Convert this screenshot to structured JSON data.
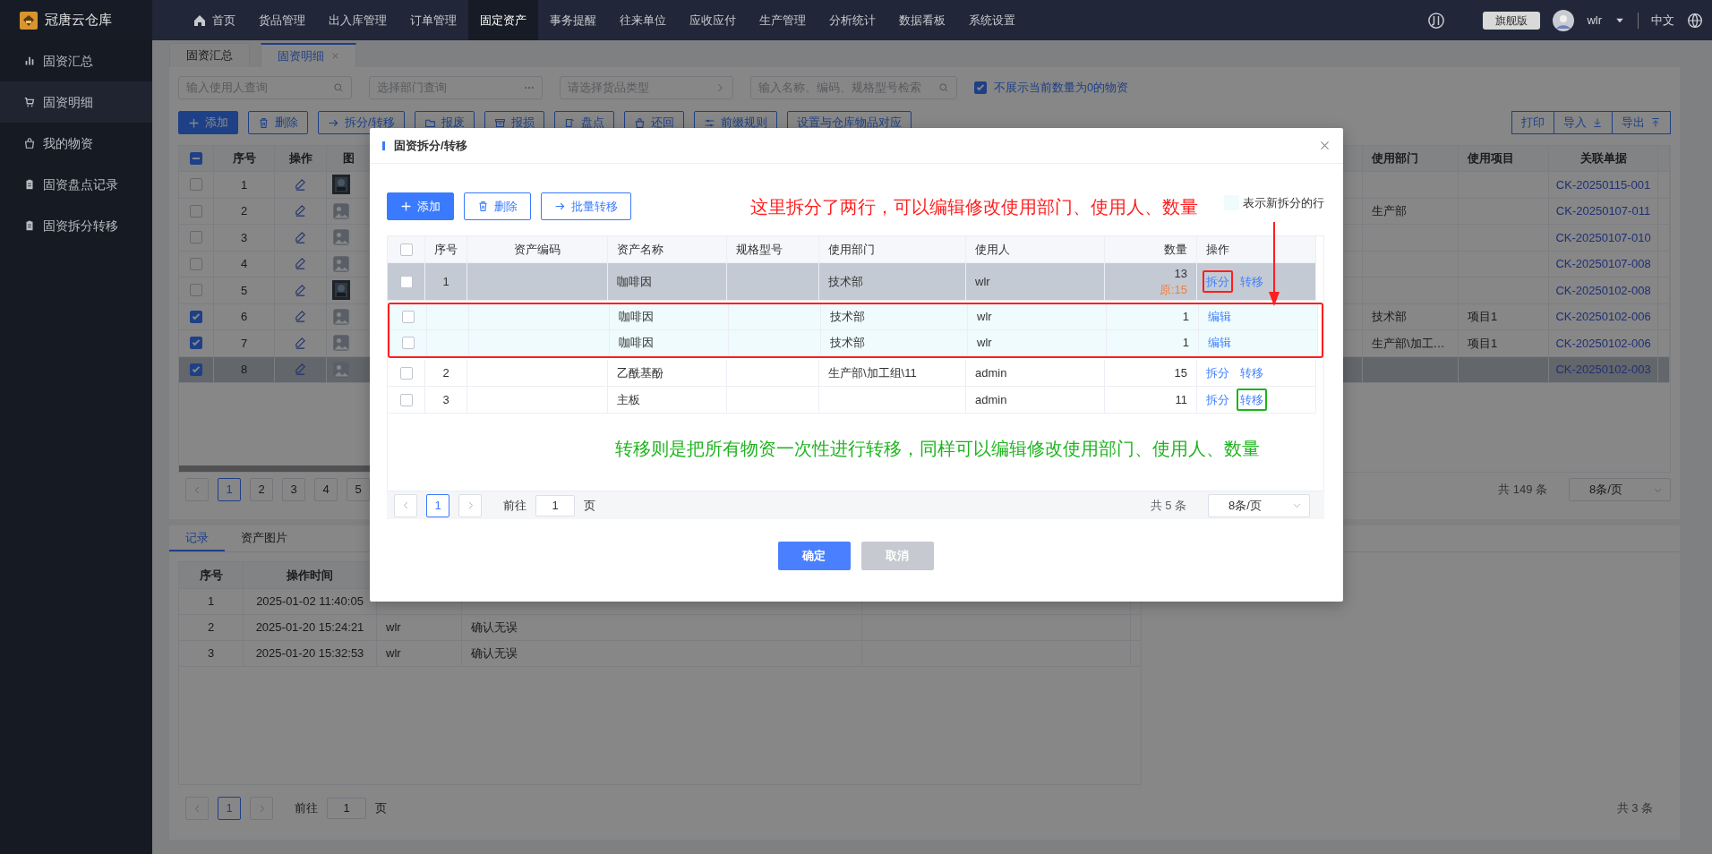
{
  "app": {
    "logo_text": "冠唐云仓库"
  },
  "top_nav": {
    "items": [
      {
        "label": "首页",
        "selected": false
      },
      {
        "label": "货品管理",
        "selected": false
      },
      {
        "label": "出入库管理",
        "selected": false
      },
      {
        "label": "订单管理",
        "selected": false
      },
      {
        "label": "固定资产",
        "selected": true
      },
      {
        "label": "事务提醒",
        "selected": false
      },
      {
        "label": "往来单位",
        "selected": false
      },
      {
        "label": "应收应付",
        "selected": false
      },
      {
        "label": "生产管理",
        "selected": false
      },
      {
        "label": "分析统计",
        "selected": false
      },
      {
        "label": "数据看板",
        "selected": false
      },
      {
        "label": "系统设置",
        "selected": false
      }
    ],
    "edition": "旗舰版",
    "user": "wlr",
    "language": "中文"
  },
  "sidebar": {
    "items": [
      {
        "label": "固资汇总",
        "selected": false
      },
      {
        "label": "固资明细",
        "selected": true
      },
      {
        "label": "我的物资",
        "selected": false
      },
      {
        "label": "固资盘点记录",
        "selected": false
      },
      {
        "label": "固资拆分转移",
        "selected": false
      }
    ]
  },
  "page_tabs": [
    {
      "label": "固资汇总",
      "selected": false,
      "closable": false
    },
    {
      "label": "固资明细",
      "selected": true,
      "closable": true
    }
  ],
  "filters": [
    {
      "kind": "search",
      "placeholder": "输入使用人查询"
    },
    {
      "kind": "more",
      "placeholder": "选择部门查询"
    },
    {
      "kind": "cascade",
      "placeholder": "请选择货品类型"
    },
    {
      "kind": "search",
      "placeholder": "输入名称、编码、规格型号检索"
    }
  ],
  "hide_zero": {
    "label": "不展示当前数量为0的物资",
    "checked": true
  },
  "toolbar": [
    {
      "label": "添加",
      "kind": "primary"
    },
    {
      "label": "删除",
      "kind": "outline"
    },
    {
      "label": "拆分/转移",
      "kind": "outline"
    },
    {
      "label": "报废",
      "kind": "outline"
    },
    {
      "label": "报损",
      "kind": "outline"
    },
    {
      "label": "盘点",
      "kind": "outline"
    },
    {
      "label": "还回",
      "kind": "outline"
    },
    {
      "label": "前缀规则",
      "kind": "outline"
    },
    {
      "label": "设置与仓库物品对应",
      "kind": "outline"
    }
  ],
  "export_buttons": [
    {
      "label": "打印"
    },
    {
      "label": "导入"
    },
    {
      "label": "导出"
    }
  ],
  "asset_table": {
    "columns": [
      "序号",
      "操作",
      "图",
      "使用部门",
      "使用项目",
      "关联单据"
    ],
    "select_all_indeterminate": true,
    "rows": [
      {
        "seq": "1",
        "checked": false,
        "selected": false,
        "has_photo": true,
        "document": "CK-20250115-001"
      },
      {
        "seq": "2",
        "checked": false,
        "selected": false,
        "has_photo": false,
        "department": "生产部",
        "document": "CK-20250107-011"
      },
      {
        "seq": "3",
        "checked": false,
        "selected": false,
        "has_photo": false,
        "document": "CK-20250107-010"
      },
      {
        "seq": "4",
        "checked": false,
        "selected": false,
        "has_photo": false,
        "document": "CK-20250107-008"
      },
      {
        "seq": "5",
        "checked": false,
        "selected": false,
        "has_photo": true,
        "document": "CK-20250102-008"
      },
      {
        "seq": "6",
        "checked": true,
        "selected": false,
        "has_photo": false,
        "department": "技术部",
        "project": "项目1",
        "document": "CK-20250102-006"
      },
      {
        "seq": "7",
        "checked": true,
        "selected": false,
        "has_photo": false,
        "department": "生产部\\加工…",
        "project": "项目1",
        "document": "CK-20250102-006"
      },
      {
        "seq": "8",
        "checked": true,
        "selected": true,
        "has_photo": false,
        "document": "CK-20250102-003"
      }
    ]
  },
  "asset_pagination": {
    "pages": [
      {
        "label": "1",
        "selected": true
      },
      {
        "label": "2",
        "selected": false
      },
      {
        "label": "3",
        "selected": false
      },
      {
        "label": "4",
        "selected": false
      },
      {
        "label": "5",
        "selected": false
      }
    ],
    "total": "共 149 条",
    "page_size": "8条/页"
  },
  "detail_tabs": [
    {
      "label": "记录",
      "selected": true
    },
    {
      "label": "资产图片",
      "selected": false
    }
  ],
  "record_table": {
    "columns": [
      "序号",
      "操作时间"
    ],
    "rows": [
      {
        "seq": "1",
        "time": "2025-01-02 11:40:05"
      },
      {
        "seq": "2",
        "time": "2025-01-20 15:24:21",
        "user": "wlr",
        "content": "确认无误"
      },
      {
        "seq": "3",
        "time": "2025-01-20 15:32:53",
        "user": "wlr",
        "content": "确认无误"
      }
    ]
  },
  "record_pagination": {
    "pages": [
      {
        "label": "1",
        "selected": true
      }
    ],
    "goto_label": "前往",
    "goto_value": "1",
    "unit": "页",
    "total": "共 3 条"
  },
  "modal": {
    "title": "固资拆分/转移",
    "buttons": [
      {
        "label": "添加",
        "kind": "primary"
      },
      {
        "label": "删除",
        "kind": "outline"
      },
      {
        "label": "批量转移",
        "kind": "outline"
      }
    ],
    "notes": [
      {
        "kind": "top",
        "text": "这里拆分了两行，可以编辑修改使用部门、使用人、数量",
        "color": "#ff1e1e"
      },
      {
        "kind": "bottom",
        "text": "转移则是把所有物资一次性进行转移，同样可以编辑修改使用部门、使用人、数量",
        "color": "#1fb41f"
      }
    ],
    "legend": {
      "label": "表示新拆分的行"
    },
    "columns": [
      "序号",
      "资产编码",
      "资产名称",
      "规格型号",
      "使用部门",
      "使用人",
      "数量",
      "操作"
    ],
    "select_all": false,
    "rows": [
      {
        "kind": "item",
        "checked": false,
        "selected": true,
        "seq": "1",
        "name": "咖啡因",
        "department": "技术部",
        "user": "wlr",
        "quantity": "13",
        "original": "原:15",
        "actions": [
          {
            "label": "拆分",
            "color": "#ff1e1e"
          },
          {
            "label": "转移"
          }
        ]
      },
      {
        "kind": "split",
        "checked": false,
        "selected": false,
        "name": "咖啡因",
        "department": "技术部",
        "user": "wlr",
        "quantity": "1",
        "actions": [
          {
            "label": "编辑"
          }
        ]
      },
      {
        "kind": "split",
        "checked": false,
        "selected": false,
        "name": "咖啡因",
        "department": "技术部",
        "user": "wlr",
        "quantity": "1",
        "actions": [
          {
            "label": "编辑"
          }
        ]
      },
      {
        "kind": "item",
        "checked": false,
        "selected": false,
        "seq": "2",
        "name": "乙酰基酚",
        "department": "生产部\\加工组\\11",
        "user": "admin",
        "quantity": "15",
        "actions": [
          {
            "label": "拆分"
          },
          {
            "label": "转移"
          }
        ]
      },
      {
        "kind": "item",
        "checked": false,
        "selected": false,
        "seq": "3",
        "name": "主板",
        "user": "admin",
        "quantity": "11",
        "actions": [
          {
            "label": "拆分"
          },
          {
            "label": "转移",
            "color": "#1fb41f"
          }
        ]
      }
    ],
    "pagination": {
      "pages": [
        {
          "label": "1",
          "selected": true
        }
      ],
      "goto_label": "前往",
      "goto_value": "1",
      "unit": "页",
      "total": "共 5 条",
      "page_size": "8条/页"
    },
    "footer": [
      {
        "label": "确定",
        "kind": "primary"
      },
      {
        "label": "取消",
        "kind": "secondary"
      }
    ]
  }
}
